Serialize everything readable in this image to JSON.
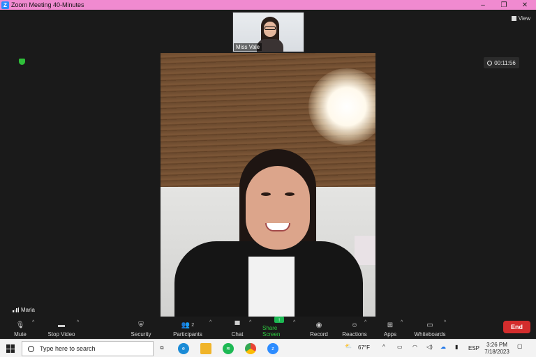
{
  "window": {
    "title": "Zoom Meeting 40-Minutes",
    "logo_letter": "Z"
  },
  "controls": {
    "minimize": "–",
    "restore": "❐",
    "close": "✕"
  },
  "view_button": {
    "label": "View"
  },
  "timer": {
    "text": "00:11:56"
  },
  "participants_strip": [
    {
      "name": "Miss Vale"
    }
  ],
  "main_speaker": {
    "name": "Maria"
  },
  "toolbar": {
    "mute": "Mute",
    "stop_video": "Stop Video",
    "security": "Security",
    "participants": "Participants",
    "participants_count": "2",
    "chat": "Chat",
    "share_screen": "Share Screen",
    "record": "Record",
    "reactions": "Reactions",
    "apps": "Apps",
    "whiteboards": "Whiteboards",
    "end": "End"
  },
  "taskbar": {
    "search_placeholder": "Type here to search",
    "weather": "67°F",
    "language": "ESP",
    "time": "3:26 PM",
    "date": "7/18/2023"
  },
  "colors": {
    "titlebar": "#f08ad0",
    "share_green": "#1db954",
    "end_red": "#d32d2d",
    "stage_bg": "#1a1a1a"
  }
}
